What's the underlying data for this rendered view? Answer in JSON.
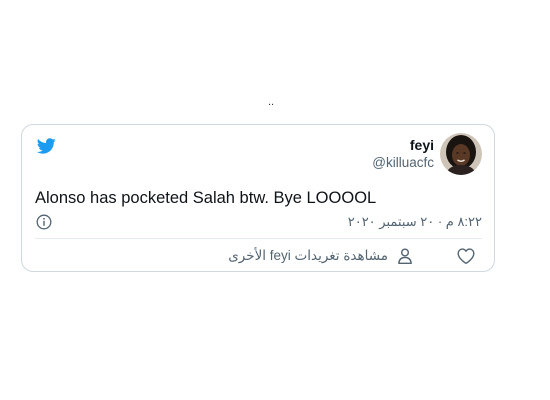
{
  "top_marker": "..",
  "tweet": {
    "author": {
      "display_name": "feyi",
      "handle": "@killuacfc"
    },
    "text": "Alonso has pocketed Salah btw. Bye LOOOOL",
    "timestamp": "٨:٢٢ م · ٢٠ سبتمبر ٢٠٢٠",
    "actions": {
      "view_more_label": "مشاهدة تغريدات feyi الأخرى"
    }
  },
  "icons": {
    "logo": "twitter-bird-icon",
    "info": "info-icon",
    "person": "person-icon",
    "like": "heart-icon"
  },
  "colors": {
    "brand_blue": "#1d9bf0",
    "text_primary": "#0f1419",
    "text_secondary": "#536471",
    "border": "#cfd9de"
  }
}
